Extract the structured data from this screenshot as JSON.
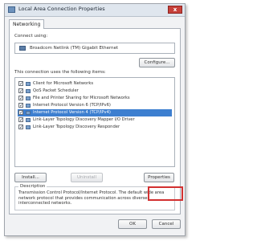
{
  "window": {
    "title": "Local Area Connection Properties",
    "close_label": "x"
  },
  "tab": {
    "label": "Networking"
  },
  "connect": {
    "label": "Connect using:",
    "adapter": "Broadcom Netlink (TM) Gigabit Ethernet",
    "configure_label": "Configure..."
  },
  "items": {
    "label": "This connection uses the following items:",
    "list": [
      {
        "label": "Client for Microsoft Networks",
        "checked": true,
        "selected": false
      },
      {
        "label": "QoS Packet Scheduler",
        "checked": true,
        "selected": false
      },
      {
        "label": "File and Printer Sharing for Microsoft Networks",
        "checked": true,
        "selected": false
      },
      {
        "label": "Internet Protocol Version 6 (TCP/IPv6)",
        "checked": true,
        "selected": false
      },
      {
        "label": "Internet Protocol Version 4 (TCP/IPv4)",
        "checked": true,
        "selected": true
      },
      {
        "label": "Link-Layer Topology Discovery Mapper I/O Driver",
        "checked": true,
        "selected": false
      },
      {
        "label": "Link-Layer Topology Discovery Responder",
        "checked": true,
        "selected": false
      }
    ]
  },
  "buttons": {
    "install": "Install...",
    "uninstall": "Uninstall",
    "properties": "Properties",
    "ok": "OK",
    "cancel": "Cancel"
  },
  "description": {
    "title": "Description",
    "text": "Transmission Control Protocol/Internet Protocol. The default wide area network protocol that provides communication across diverse interconnected networks."
  },
  "colors": {
    "selection": "#3d7fd0",
    "highlight_box": "#d23030"
  }
}
